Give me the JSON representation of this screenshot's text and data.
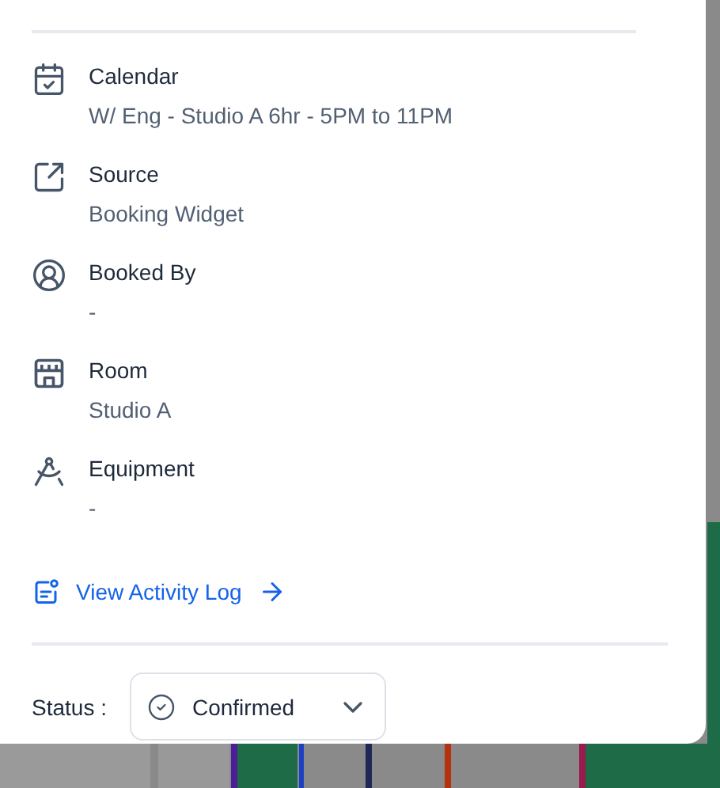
{
  "details": [
    {
      "kind": "calendar",
      "label": "Calendar",
      "value": "W/ Eng - Studio A 6hr - 5PM to 11PM"
    },
    {
      "kind": "source",
      "label": "Source",
      "value": "Booking Widget"
    },
    {
      "kind": "person",
      "label": "Booked By",
      "value": "-"
    },
    {
      "kind": "room",
      "label": "Room",
      "value": "Studio A"
    },
    {
      "kind": "equipment",
      "label": "Equipment",
      "value": "-"
    }
  ],
  "activity_link": {
    "label": "View Activity Log"
  },
  "status": {
    "label": "Status :",
    "value": "Confirmed"
  }
}
